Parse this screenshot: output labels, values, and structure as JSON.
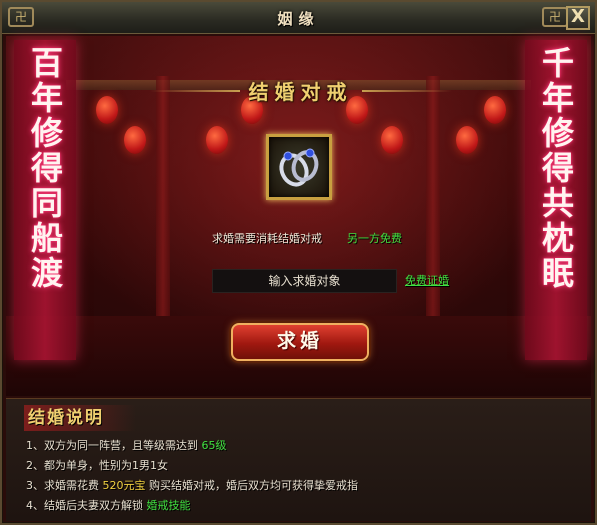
{
  "window": {
    "title": "姻缘",
    "close_label": "X",
    "corner_ornament": "卍"
  },
  "banners": {
    "left": "百年修得同船渡",
    "right": "千年修得共枕眠"
  },
  "header": {
    "title": "结婚对戒"
  },
  "ring": {
    "icon": "wedding-rings-icon"
  },
  "cost": {
    "need_text": "求婚需要消耗结婚对戒",
    "free_text": "另一方免费"
  },
  "target": {
    "placeholder": "输入求婚对象",
    "free_cert_link": "免费证婚"
  },
  "propose": {
    "label": "求婚"
  },
  "explanation": {
    "title": "结婚说明",
    "rules": [
      {
        "prefix": "1、双方为同一阵营，且等级需达到 ",
        "highlight": "65级",
        "suffix": ""
      },
      {
        "prefix": "2、都为单身，性别为1男1女",
        "highlight": "",
        "suffix": ""
      },
      {
        "prefix": "3、求婚需花费 ",
        "highlight": "520元宝",
        "suffix": " 购买结婚对戒，婚后双方均可获得挚爱戒指"
      },
      {
        "prefix": "4、结婚后夫妻双方解锁 ",
        "highlight": "婚戒技能",
        "suffix": ""
      }
    ]
  },
  "colors": {
    "accent_gold": "#f0d070",
    "highlight_green": "#40e040",
    "highlight_yellow": "#f0d040",
    "button_red": "#a01810"
  }
}
